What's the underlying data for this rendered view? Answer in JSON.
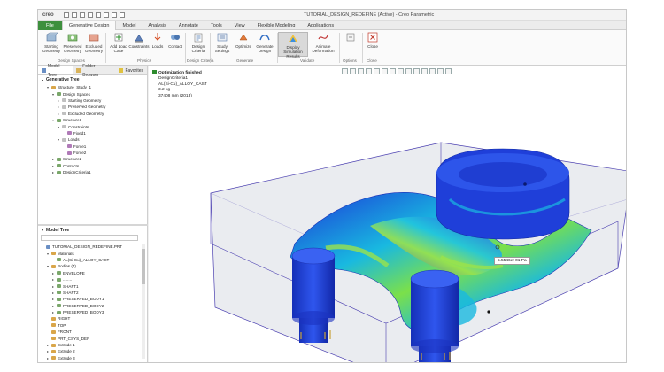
{
  "window": {
    "logo": "creo",
    "title": "TUTORIAL_DESIGN_REDEFINE (Active) - Creo Parametric"
  },
  "ribbon_tabs": [
    {
      "label": "File"
    },
    {
      "label": "Generative Design"
    },
    {
      "label": "Model"
    },
    {
      "label": "Analysis"
    },
    {
      "label": "Annotate"
    },
    {
      "label": "Tools"
    },
    {
      "label": "View"
    },
    {
      "label": "Flexible Modeling"
    },
    {
      "label": "Applications"
    }
  ],
  "ribbon": {
    "buttons": [
      {
        "line1": "Starting",
        "line2": "Geometry"
      },
      {
        "line1": "Preserved",
        "line2": "Geometry"
      },
      {
        "line1": "Excluded",
        "line2": "Geometry"
      },
      {
        "line1": "Add Load",
        "line2": "Case"
      },
      {
        "line1": "Constraints",
        "line2": ""
      },
      {
        "line1": "Loads",
        "line2": ""
      },
      {
        "line1": "Contact",
        "line2": ""
      },
      {
        "line1": "Design",
        "line2": "Criteria"
      },
      {
        "line1": "Study",
        "line2": "Settings"
      },
      {
        "line1": "Optimize",
        "line2": ""
      },
      {
        "line1": "Generate",
        "line2": "Design"
      },
      {
        "line1": "Display",
        "line2": "Simulation Results"
      },
      {
        "line1": "Animate",
        "line2": "Deformation"
      },
      {
        "line1": "Close",
        "line2": ""
      }
    ],
    "groups": {
      "design_spaces": "Design Spaces",
      "physics": "Physics",
      "design_criteria": "Design Criteria",
      "generate": "Generate",
      "validate": "Validate",
      "options": "Options",
      "close": "Close"
    }
  },
  "panel_tabs": {
    "model_tree": "Model Tree",
    "folder_browser": "Folder Browser",
    "favorites": "Favorites"
  },
  "generative_tree": {
    "header": "Generative Tree",
    "rows": [
      {
        "label": "Structure_Study_1",
        "level": 1,
        "toggle": "▾"
      },
      {
        "label": "Design Spaces",
        "level": 2,
        "toggle": "▾"
      },
      {
        "label": "Starting Geometry",
        "level": 3,
        "toggle": "▸"
      },
      {
        "label": "Preserved Geometry",
        "level": 3,
        "toggle": "▸"
      },
      {
        "label": "Excluded Geometry",
        "level": 3,
        "toggle": "▸"
      },
      {
        "label": "Structure1",
        "level": 2,
        "toggle": "▾"
      },
      {
        "label": "Constraints",
        "level": 3,
        "toggle": "▾"
      },
      {
        "label": "Fixed1",
        "level": 4,
        "toggle": ""
      },
      {
        "label": "Loads",
        "level": 3,
        "toggle": "▾"
      },
      {
        "label": "Force1",
        "level": 4,
        "toggle": ""
      },
      {
        "label": "Force2",
        "level": 4,
        "toggle": ""
      },
      {
        "label": "Structure2",
        "level": 2,
        "toggle": "▸"
      },
      {
        "label": "Contacts",
        "level": 2,
        "toggle": "▸"
      },
      {
        "label": "DesignCriteria1",
        "level": 2,
        "toggle": "▸"
      }
    ]
  },
  "model_tree": {
    "header": "Model Tree",
    "rows": [
      {
        "label": "TUTORIAL_DESIGN_REDEFINE.PRT",
        "level": 0,
        "toggle": ""
      },
      {
        "label": "Materials",
        "level": 1,
        "toggle": "▾"
      },
      {
        "label": "AL(Si-Cu)_ALLOY_CAST",
        "level": 2,
        "toggle": ""
      },
      {
        "label": "Bodies (7)",
        "level": 1,
        "toggle": "▾"
      },
      {
        "label": "ENVELOPE",
        "level": 2,
        "toggle": "▸"
      },
      {
        "label": "........",
        "level": 2,
        "toggle": "▸"
      },
      {
        "label": "SHAFT1",
        "level": 2,
        "toggle": "▸"
      },
      {
        "label": "SHAFT2",
        "level": 2,
        "toggle": "▸"
      },
      {
        "label": "PRESERVED_BODY1",
        "level": 2,
        "toggle": "▸"
      },
      {
        "label": "PRESERVED_BODY2",
        "level": 2,
        "toggle": "▸"
      },
      {
        "label": "PRESERVED_BODY3",
        "level": 2,
        "toggle": "▸"
      },
      {
        "label": "RIGHT",
        "level": 1,
        "toggle": ""
      },
      {
        "label": "TOP",
        "level": 1,
        "toggle": ""
      },
      {
        "label": "FRONT",
        "level": 1,
        "toggle": ""
      },
      {
        "label": "PRT_CSYS_DEF",
        "level": 1,
        "toggle": ""
      },
      {
        "label": "Extrude 1",
        "level": 1,
        "toggle": "▸"
      },
      {
        "label": "Extrude 2",
        "level": 1,
        "toggle": "▸"
      },
      {
        "label": "Extrude 3",
        "level": 1,
        "toggle": "▸"
      },
      {
        "label": "Extrude 4",
        "level": 1,
        "toggle": "▸"
      }
    ]
  },
  "results_header": {
    "status": "Optimization finished",
    "criteria": "DesignCriteria1",
    "material": "AL(Si-Cu)_ALLOY_CAST",
    "mass": "3.2 kg",
    "volume": "37408 mm (2013)"
  },
  "probe_tooltip": "5.5546e+01 Pa",
  "colors": {
    "file_tab": "#3d8f3d",
    "stress_low": "#1a35d8",
    "stress_mid": "#19b9e0",
    "stress_high": "#7be04a"
  }
}
